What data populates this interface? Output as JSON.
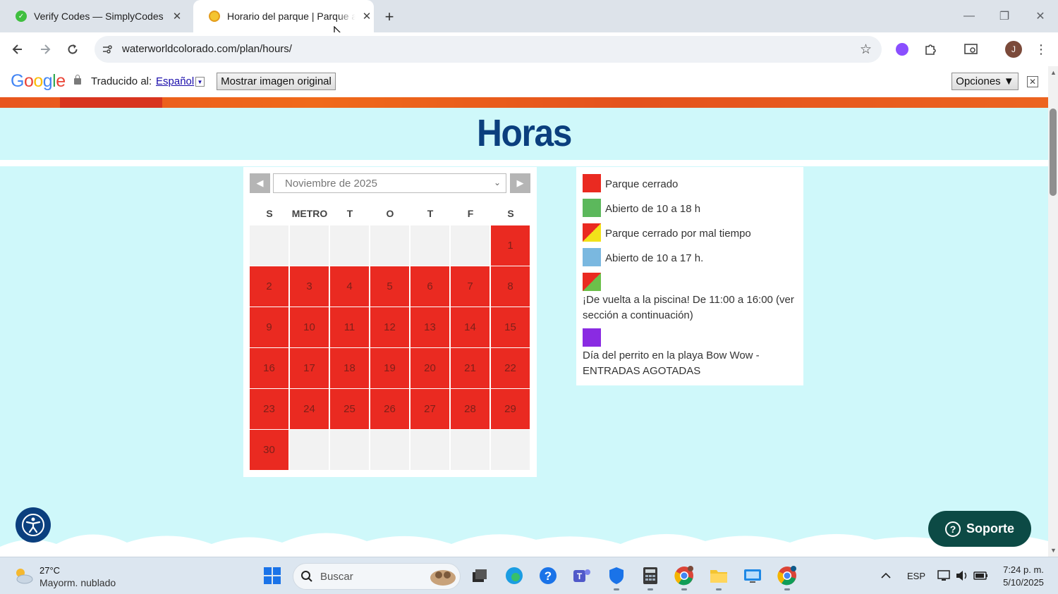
{
  "browser": {
    "tabs": [
      {
        "title": "Verify Codes — SimplyCodes",
        "favicon": "simplycodes-icon",
        "active": false
      },
      {
        "title": "Horario del parque | Parque acuático",
        "favicon": "waterworld-icon",
        "active": true
      }
    ],
    "new_tab": "+",
    "url": "waterworldcolorado.com/plan/hours/",
    "profile_initial": "J"
  },
  "translate_bar": {
    "logo": "Google",
    "translated_to": "Traducido al:",
    "language": "Español",
    "language_arrow": "▼",
    "show_original": "Mostrar imagen original",
    "options": "Opciones ▼",
    "close": "✕"
  },
  "page": {
    "title": "Horas",
    "calendar": {
      "month": "Noviembre de 2025",
      "weekdays": [
        "S",
        "METRO",
        "T",
        "O",
        "T",
        "F",
        "S"
      ],
      "first_weekday_index": 6,
      "days": [
        "1",
        "2",
        "3",
        "4",
        "5",
        "6",
        "7",
        "8",
        "9",
        "10",
        "11",
        "12",
        "13",
        "14",
        "15",
        "16",
        "17",
        "18",
        "19",
        "20",
        "21",
        "22",
        "23",
        "24",
        "25",
        "26",
        "27",
        "28",
        "29",
        "30"
      ],
      "status_all_days": "closed"
    },
    "legend": [
      {
        "label": "Parque cerrado",
        "color": "#ea2a21"
      },
      {
        "label": "Abierto de 10 a 18 h",
        "color": "#5cb85c"
      },
      {
        "label": "Parque cerrado por mal tiempo",
        "color": "split-red-yellow"
      },
      {
        "label": "Abierto de 10 a 17 h.",
        "color": "#7ab8e0"
      },
      {
        "label": "¡De vuelta a la piscina! De 11:00 a 16:00 (ver sección a continuación)",
        "color": "split-red-green"
      },
      {
        "label": "Día del perrito en la playa Bow Wow - ENTRADAS AGOTADAS",
        "color": "#8a2be2"
      }
    ],
    "support_button": "Soporte",
    "accessibility": "accessibility-icon"
  },
  "taskbar": {
    "weather_temp": "27°C",
    "weather_desc": "Mayorm. nublado",
    "search_placeholder": "Buscar",
    "language": "ESP",
    "time": "7:24 p. m.",
    "date": "5/10/2025"
  }
}
